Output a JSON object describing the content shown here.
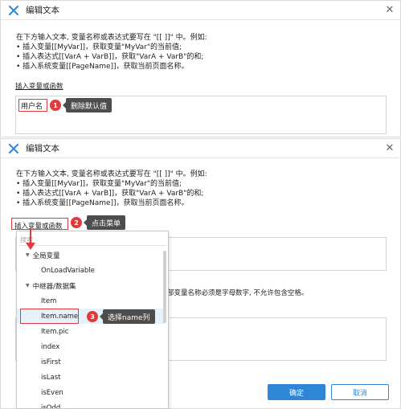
{
  "dialog1": {
    "title": "编辑文本",
    "instructions": [
      "在下方输入文本, 变量名称或表达式要写在 \"[[ ]]\" 中。例如:",
      "• 插入变量[[MyVar]]，获取变量\"MyVar\"的当前值;",
      "• 插入表达式[[VarA + VarB]]，获取\"VarA + VarB\"的和;",
      "• 插入系统变量[[PageName]]，获取当前页面名称。"
    ],
    "insert_link": "插入变量或函数",
    "text_value": "用户名",
    "step_number": "1",
    "step_label": "删除默认值"
  },
  "dialog2": {
    "title": "编辑文本",
    "instructions": [
      "在下方输入文本, 变量名称或表达式要写在 \"[[ ]]\" 中。例如:",
      "• 插入变量[[MyVar]]，获取变量\"MyVar\"的当前值;",
      "• 插入表达式[[VarA + VarB]]，获取\"VarA + VarB\"的和;",
      "• 插入系统变量[[PageName]]，获取当前页面名称。"
    ],
    "insert_link": "插入变量或函数",
    "step2_number": "2",
    "step2_label": "点击菜单",
    "step3_number": "3",
    "step3_label": "选择name列",
    "note_text": "部变量名称必须是字母数字, 不允许包含空格。",
    "ok_label": "确定",
    "cancel_label": "取消"
  },
  "dropdown": {
    "search_placeholder": "搜索",
    "items": [
      {
        "label": "全局变量",
        "kind": "group"
      },
      {
        "label": "OnLoadVariable",
        "kind": "leaf"
      },
      {
        "label": "中继器/数据集",
        "kind": "group"
      },
      {
        "label": "Item",
        "kind": "leaf"
      },
      {
        "label": "Item.name",
        "kind": "leaf",
        "selected": true
      },
      {
        "label": "Item.pic",
        "kind": "leaf"
      },
      {
        "label": "index",
        "kind": "leaf"
      },
      {
        "label": "isFirst",
        "kind": "leaf"
      },
      {
        "label": "isLast",
        "kind": "leaf"
      },
      {
        "label": "isEven",
        "kind": "leaf"
      },
      {
        "label": "isOdd",
        "kind": "leaf"
      }
    ]
  },
  "colors": {
    "accent_blue": "#2f86d6",
    "annotation_red": "#e23a3a",
    "callout_bg": "#4d4d4d",
    "logo_blue": "#2f86d6"
  },
  "icons": {
    "logo": "axure-x-logo-icon",
    "close": "close-icon",
    "caret": "caret-down-icon",
    "arrow": "red-down-arrow-icon"
  }
}
